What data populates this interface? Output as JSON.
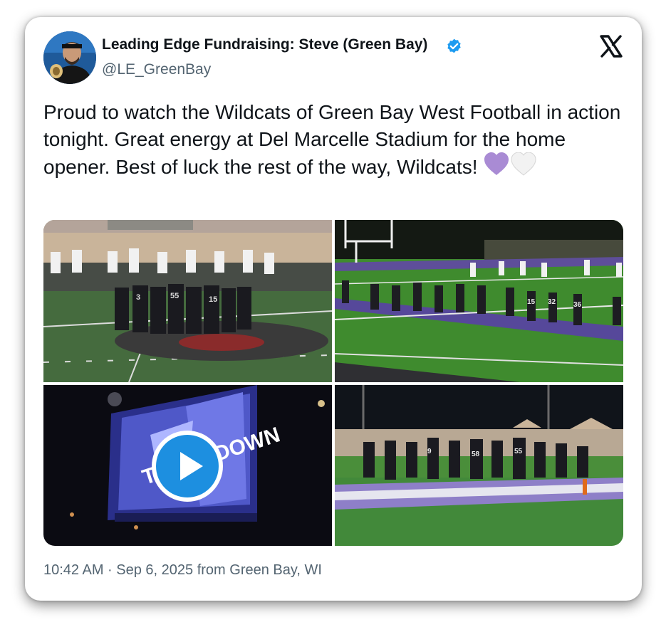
{
  "author": {
    "display_name": "Leading Edge Fundraising: Steve (Green Bay)",
    "handle": "@LE_GreenBay",
    "verified": true,
    "avatar_icon": "profile-photo"
  },
  "brand": {
    "logo_icon": "x-logo-icon"
  },
  "tweet": {
    "text": "Proud to watch the Wildcats of Green Bay West Football in action tonight. Great energy at Del Marcelle Stadium for the home opener. Best of luck the rest of the way, Wildcats!",
    "emoji": [
      "purple-heart",
      "white-heart"
    ]
  },
  "media": {
    "count": 4,
    "video_overlay_text": "TOUCHDOWN",
    "play_icon": "play-icon",
    "jersey_numbers": [
      "55",
      "3",
      "15",
      "32",
      "36",
      "58",
      "9"
    ]
  },
  "meta": {
    "timestamp": "10:42 AM · Sep 6, 2025 from Green Bay, WI"
  },
  "colors": {
    "accent_blue": "#1d9bf0",
    "purple_heart": "#a98bd4",
    "text_primary": "#0f1419",
    "text_secondary": "#536471",
    "team_purple": "#4b3a8c"
  }
}
